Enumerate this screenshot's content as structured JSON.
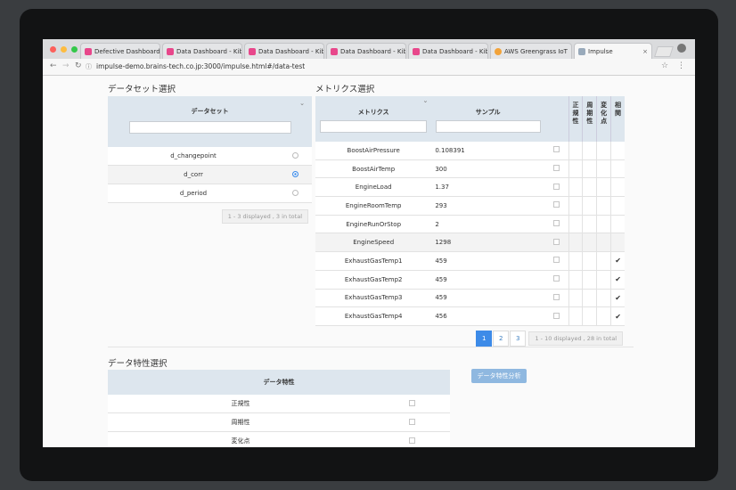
{
  "browser": {
    "tabs": [
      {
        "label": "Defective Dashboard -"
      },
      {
        "label": "Data Dashboard - Kiba"
      },
      {
        "label": "Data Dashboard - Kiba"
      },
      {
        "label": "Data Dashboard - Kiba"
      },
      {
        "label": "Data Dashboard - Kiba"
      },
      {
        "label": "AWS Greengrass IoT"
      },
      {
        "label": "Impulse"
      }
    ],
    "url": "impulse-demo.brains-tech.co.jp:3000/impulse.html#/data-test"
  },
  "dataset": {
    "title": "データセット選択",
    "header": "データセット",
    "rows": [
      {
        "name": "d_changepoint",
        "selected": false
      },
      {
        "name": "d_corr",
        "selected": true
      },
      {
        "name": "d_period",
        "selected": false
      }
    ],
    "footer": "1 - 3 displayed , 3 in total"
  },
  "metrics": {
    "title": "メトリクス選択",
    "col_metric": "メトリクス",
    "col_sample": "サンプル",
    "col_flags": [
      "正規性",
      "周期性",
      "変化点",
      "相関"
    ],
    "rows": [
      {
        "name": "BoostAirPressure",
        "sample": "0.108391",
        "corr": ""
      },
      {
        "name": "BoostAirTemp",
        "sample": "300",
        "corr": ""
      },
      {
        "name": "EngineLoad",
        "sample": "1.37",
        "corr": ""
      },
      {
        "name": "EngineRoomTemp",
        "sample": "293",
        "corr": ""
      },
      {
        "name": "EngineRunOrStop",
        "sample": "2",
        "corr": ""
      },
      {
        "name": "EngineSpeed",
        "sample": "1298",
        "corr": ""
      },
      {
        "name": "ExhaustGasTemp1",
        "sample": "459",
        "corr": "✔"
      },
      {
        "name": "ExhaustGasTemp2",
        "sample": "459",
        "corr": "✔"
      },
      {
        "name": "ExhaustGasTemp3",
        "sample": "459",
        "corr": "✔"
      },
      {
        "name": "ExhaustGasTemp4",
        "sample": "456",
        "corr": "✔"
      }
    ],
    "pages": [
      "1",
      "2",
      "3"
    ],
    "footer": "1 - 10 displayed , 28 in total"
  },
  "features": {
    "title": "データ特性選択",
    "header": "データ特性",
    "rows": [
      "正規性",
      "周期性",
      "変化点"
    ],
    "analyze_button": "データ特性分析"
  },
  "colors": {
    "accent": "#3d8be8",
    "header_bg": "#dde6ee"
  }
}
